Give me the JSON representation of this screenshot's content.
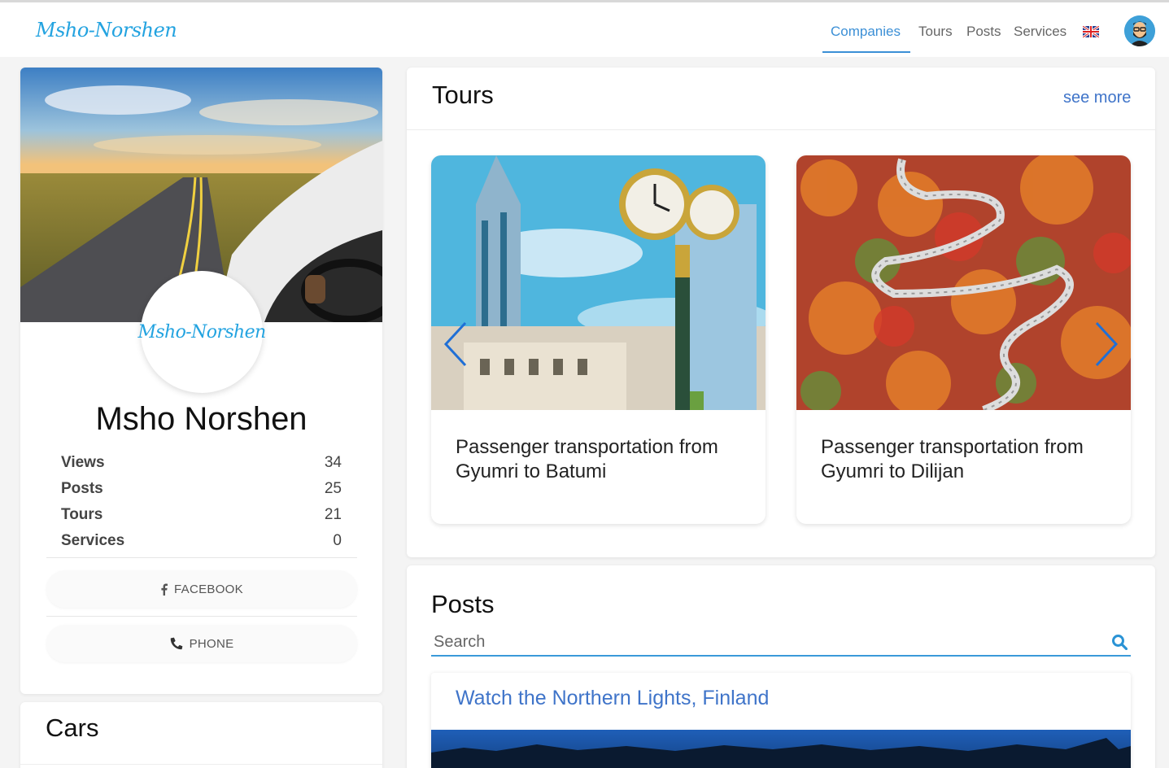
{
  "nav": {
    "logo": "Msho-Norshen",
    "links": [
      "Companies",
      "Tours",
      "Posts",
      "Services"
    ],
    "active": "Companies",
    "language_icon": "uk-flag-icon"
  },
  "profile": {
    "logo_text": "Msho-Norshen",
    "name": "Msho Norshen",
    "stats": [
      {
        "label": "Views",
        "value": "34"
      },
      {
        "label": "Posts",
        "value": "25"
      },
      {
        "label": "Tours",
        "value": "21"
      },
      {
        "label": "Services",
        "value": "0"
      }
    ],
    "facebook_label": "FACEBOOK",
    "phone_label": "PHONE"
  },
  "cars": {
    "title": "Cars"
  },
  "tours": {
    "title": "Tours",
    "see_more": "see more",
    "items": [
      {
        "title": "Passenger transportation from Gyumri to Batumi"
      },
      {
        "title": "Passenger transportation from Gyumri to Dilijan"
      }
    ]
  },
  "posts": {
    "title": "Posts",
    "search_placeholder": "Search",
    "items": [
      {
        "title": "Watch the Northern Lights, Finland"
      }
    ]
  },
  "colors": {
    "accent": "#3b8fd6",
    "logo": "#23a3e0",
    "link": "#3f74c9"
  }
}
